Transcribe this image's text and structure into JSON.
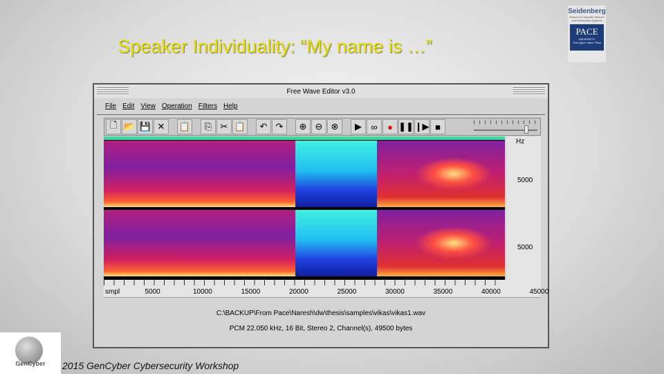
{
  "slide": {
    "title": "Speaker Individuality: “My name is …”",
    "footer": "2015 GenCyber Cybersecurity Workshop",
    "logo_right": {
      "line1": "Seidenberg",
      "line2": "School of Computer Science and Information Systems",
      "line3": "PACE",
      "line4": "UNIVERSITY",
      "line5": "The Upper Hand. Pace"
    },
    "logo_left": "GenCyber"
  },
  "window": {
    "title": "Free Wave Editor v3.0",
    "menu": [
      "File",
      "Edit",
      "View",
      "Operation",
      "Filters",
      "Help"
    ],
    "toolbar": [
      {
        "name": "new-file",
        "glyph": "🗋"
      },
      {
        "name": "open-folder",
        "glyph": "📂"
      },
      {
        "name": "save",
        "glyph": "💾"
      },
      {
        "name": "close",
        "glyph": "✕"
      },
      {
        "name": "properties",
        "glyph": "📋"
      },
      {
        "name": "copy",
        "glyph": "⎘"
      },
      {
        "name": "cut",
        "glyph": "✂"
      },
      {
        "name": "paste",
        "glyph": "📋"
      },
      {
        "name": "undo",
        "glyph": "↶"
      },
      {
        "name": "redo",
        "glyph": "↷"
      },
      {
        "name": "zoom-in",
        "glyph": "⊕"
      },
      {
        "name": "zoom-out",
        "glyph": "⊖"
      },
      {
        "name": "zoom-fit",
        "glyph": "⊗"
      },
      {
        "name": "play",
        "glyph": "▶"
      },
      {
        "name": "loop",
        "glyph": "∞"
      },
      {
        "name": "record",
        "glyph": "●"
      },
      {
        "name": "pause",
        "glyph": "❚❚"
      },
      {
        "name": "play-selection",
        "glyph": "❙▶"
      },
      {
        "name": "stop",
        "glyph": "■"
      }
    ],
    "volume": 0.85,
    "hz_axis": {
      "unit": "Hz",
      "ch1": "5000",
      "ch2": "5000"
    },
    "x_axis": [
      "smpl",
      "5000",
      "10000",
      "15000",
      "20000",
      "25000",
      "30000",
      "35000",
      "40000",
      "45000"
    ],
    "file_path": "C:\\BACKUP\\From Pace\\Naresh\\dw\\thesis\\samples\\vikas\\vikas1.wav",
    "format": "PCM 22.050 kHz, 16 Bit, Stereo 2, Channel(s), 49500 bytes",
    "colors": {
      "selection": "#20c0f0",
      "spectrum": "#d02060",
      "marker": "#40d8a0"
    }
  }
}
